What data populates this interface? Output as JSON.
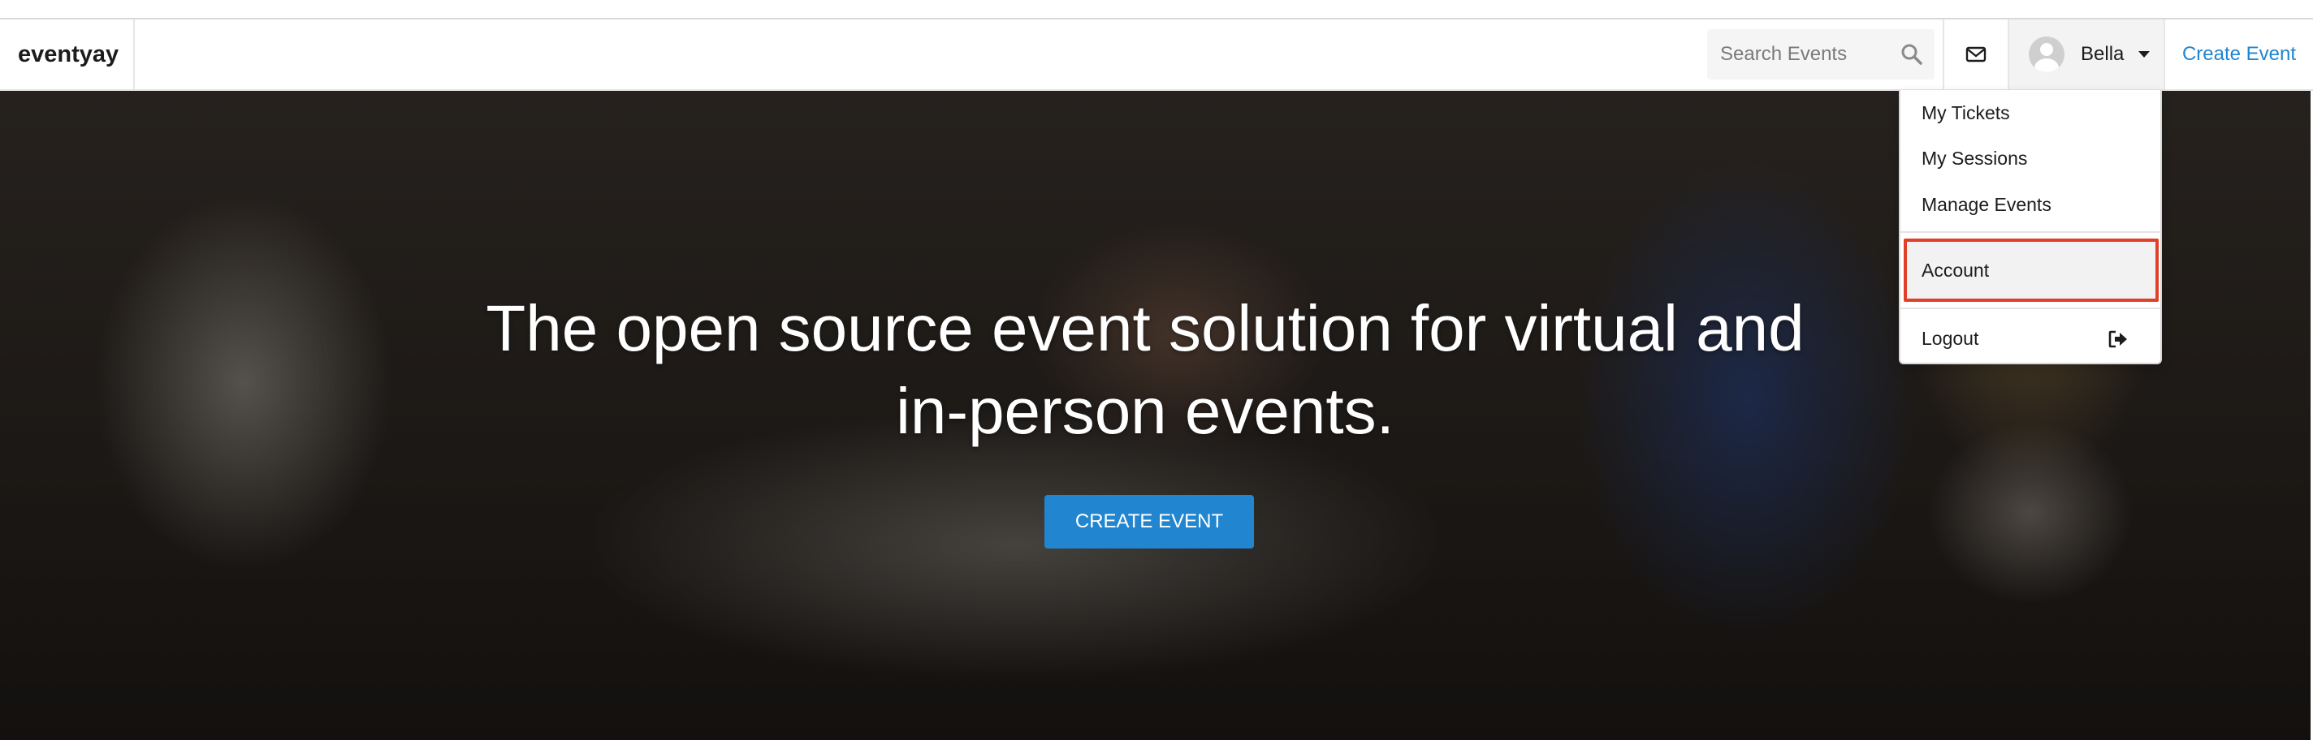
{
  "navbar": {
    "brand": "eventyay",
    "search_placeholder": "Search Events",
    "user_name": "Bella",
    "create_event_link": "Create Event"
  },
  "hero": {
    "headline": "The open source event solution for virtual and in-person events.",
    "cta_label": "CREATE EVENT"
  },
  "user_menu": {
    "items": [
      {
        "label": "My Tickets"
      },
      {
        "label": "My Sessions"
      },
      {
        "label": "Manage Events"
      },
      {
        "label": "Account",
        "highlighted": true
      },
      {
        "label": "Logout",
        "icon": "sign-out-icon"
      }
    ]
  },
  "colors": {
    "accent": "#2185d0",
    "highlight_border": "#e0402a",
    "text": "#1b1c1d"
  }
}
